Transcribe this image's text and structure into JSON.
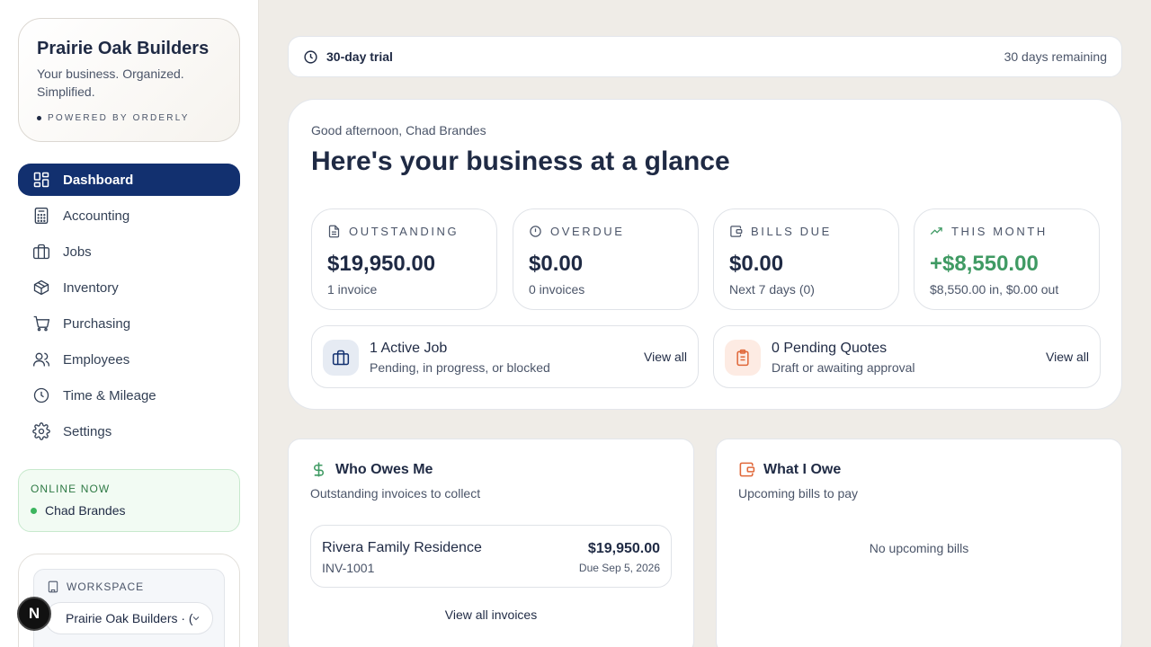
{
  "brand": {
    "name": "Prairie Oak Builders",
    "tagline": "Your business. Organized. Simplified.",
    "powered_by": "POWERED BY ORDERLY"
  },
  "nav": {
    "items": [
      {
        "label": "Dashboard",
        "icon": "dashboard-icon",
        "active": true
      },
      {
        "label": "Accounting",
        "icon": "calculator-icon"
      },
      {
        "label": "Jobs",
        "icon": "briefcase-icon"
      },
      {
        "label": "Inventory",
        "icon": "box-icon"
      },
      {
        "label": "Purchasing",
        "icon": "cart-icon"
      },
      {
        "label": "Employees",
        "icon": "users-icon"
      },
      {
        "label": "Time & Mileage",
        "icon": "clock-icon"
      },
      {
        "label": "Settings",
        "icon": "gear-icon"
      }
    ]
  },
  "online": {
    "title": "ONLINE NOW",
    "user": "Chad Brandes"
  },
  "workspace": {
    "label": "WORKSPACE",
    "selected": "Prairie Oak Builders · (",
    "badge": "N"
  },
  "trial": {
    "label": "30-day trial",
    "remaining": "30 days remaining"
  },
  "glance": {
    "greeting": "Good afternoon, Chad Brandes",
    "headline": "Here's your business at a glance",
    "stats": [
      {
        "label": "OUTSTANDING",
        "value": "$19,950.00",
        "sub": "1 invoice",
        "icon": "document-icon"
      },
      {
        "label": "OVERDUE",
        "value": "$0.00",
        "sub": "0 invoices",
        "icon": "alert-circle-icon"
      },
      {
        "label": "BILLS DUE",
        "value": "$0.00",
        "sub": "Next 7 days (0)",
        "icon": "wallet-icon"
      },
      {
        "label": "THIS MONTH",
        "value": "+$8,550.00",
        "sub": "$8,550.00 in, $0.00 out",
        "icon": "trending-up-icon"
      }
    ],
    "jobs": {
      "title": "1 Active Job",
      "sub": "Pending, in progress, or blocked",
      "link": "View all"
    },
    "quotes": {
      "title": "0 Pending Quotes",
      "sub": "Draft or awaiting approval",
      "link": "View all"
    }
  },
  "owes_me": {
    "title": "Who Owes Me",
    "sub": "Outstanding invoices to collect",
    "invoices": [
      {
        "client": "Rivera Family Residence",
        "number": "INV-1001",
        "amount": "$19,950.00",
        "due": "Due Sep 5, 2026"
      }
    ],
    "link": "View all invoices"
  },
  "i_owe": {
    "title": "What I Owe",
    "sub": "Upcoming bills to pay",
    "empty": "No upcoming bills"
  },
  "colors": {
    "nav_active": "#12306f",
    "positive": "#3f9a63",
    "online_green": "#3cb55e",
    "quotes_accent": "#e0683a"
  }
}
